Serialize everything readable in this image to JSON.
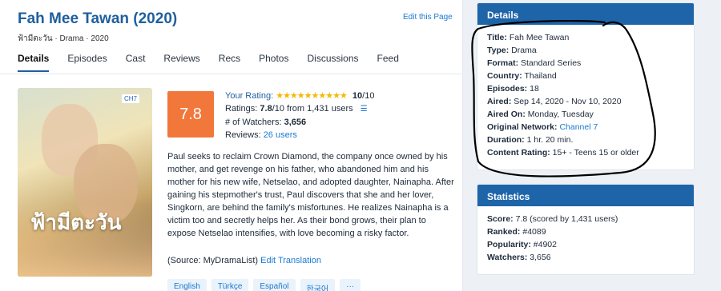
{
  "header": {
    "title": "Fah Mee Tawan (2020)",
    "edit_label": "Edit this Page",
    "native_line": "ฟ้ามีตะวัน · Drama · 2020"
  },
  "tabs": [
    "Details",
    "Episodes",
    "Cast",
    "Reviews",
    "Recs",
    "Photos",
    "Discussions",
    "Feed"
  ],
  "poster": {
    "overlay_text": "ฟ้ามีตะวัน",
    "channel_badge": "CH7"
  },
  "rating": {
    "score": "7.8",
    "your_rating_label": "Your Rating:",
    "stars": "★★★★★★★★★★",
    "your_rating_value": "10",
    "your_rating_max": "/10",
    "ratings_label": "Ratings:",
    "ratings_value": "7.8",
    "ratings_suffix": "/10 from 1,431 users",
    "watchers_label": "# of Watchers:",
    "watchers_value": "3,656",
    "reviews_label": "Reviews:",
    "reviews_value": "26 users"
  },
  "synopsis": "Paul seeks to reclaim Crown Diamond, the company once owned by his mother, and get revenge on his father, who abandoned him and his mother for his new wife, Netselao, and adopted daughter, Nainapha. After gaining his stepmother's trust, Paul discovers that she and her lover, Singkorn, are behind the family's misfortunes. He realizes Nainapha is a victim too and secretly helps her. As their bond grows, their plan to expose Netselao intensifies, with love becoming a risky factor.",
  "source": {
    "prefix": "(Source: MyDramaList)",
    "edit_translation": "Edit Translation"
  },
  "languages": [
    "English",
    "Türkçe",
    "Español",
    "한국어",
    "···"
  ],
  "details": {
    "heading": "Details",
    "rows": [
      {
        "label": "Title:",
        "value": "Fah Mee Tawan"
      },
      {
        "label": "Type:",
        "value": "Drama"
      },
      {
        "label": "Format:",
        "value": "Standard Series"
      },
      {
        "label": "Country:",
        "value": "Thailand"
      },
      {
        "label": "Episodes:",
        "value": "18"
      },
      {
        "label": "Aired:",
        "value": "Sep 14, 2020 - Nov 10, 2020"
      },
      {
        "label": "Aired On:",
        "value": "Monday, Tuesday"
      },
      {
        "label": "Original Network:",
        "value": "Channel 7"
      },
      {
        "label": "Duration:",
        "value": "1 hr. 20 min."
      },
      {
        "label": "Content Rating:",
        "value": "15+ - Teens 15 or older"
      }
    ]
  },
  "statistics": {
    "heading": "Statistics",
    "rows": [
      {
        "label": "Score:",
        "value": "7.8 (scored by 1,431 users)"
      },
      {
        "label": "Ranked:",
        "value": "#4089"
      },
      {
        "label": "Popularity:",
        "value": "#4902"
      },
      {
        "label": "Watchers:",
        "value": "3,656"
      }
    ]
  },
  "colors": {
    "accent": "#1e64a8",
    "score_bg": "#f1773b",
    "link": "#1a7ad1",
    "star": "#f5b800"
  }
}
